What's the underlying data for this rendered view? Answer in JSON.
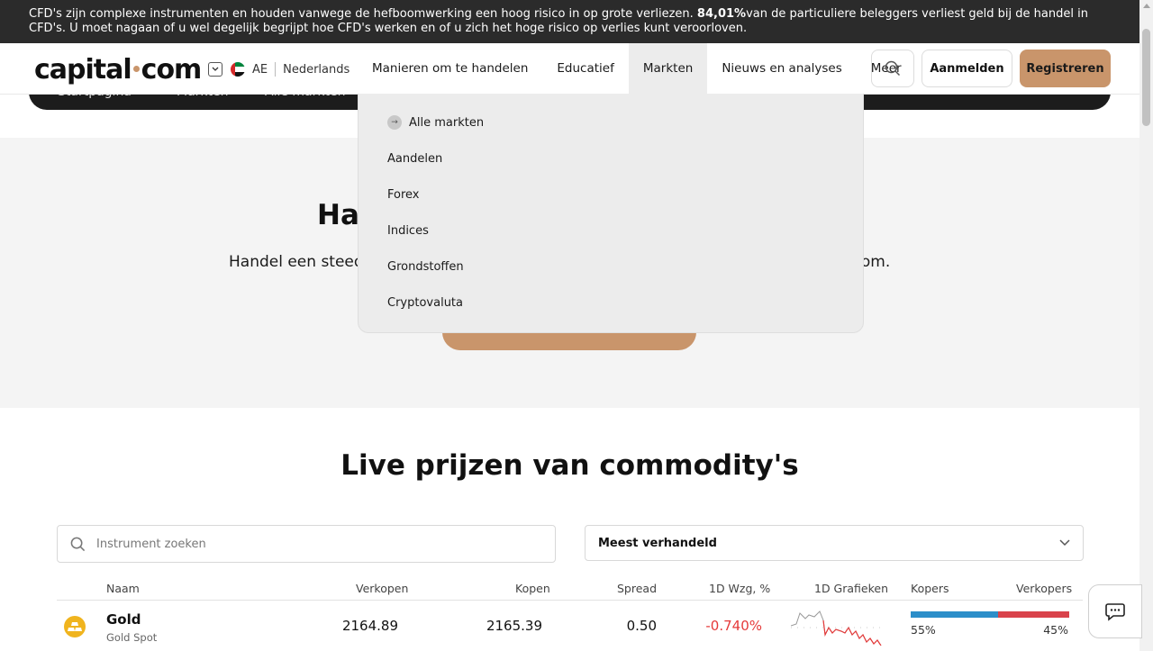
{
  "risk_warning": {
    "text_before": "CFD's zijn complexe instrumenten en houden vanwege de hefboomwerking een hoog risico in op grote verliezen. ",
    "percentage": "84,01%",
    "text_after": "van de particuliere beleggers verliest geld bij de handel in CFD's. U moet nagaan of u wel degelijk begrijpt hoe CFD's werken en of u zich het hoge risico op verlies kunt veroorloven."
  },
  "header": {
    "logo": {
      "part1": "capital",
      "part2": "com"
    },
    "region_code": "AE",
    "language": "Nederlands",
    "nav": [
      {
        "label": "Manieren om te handelen"
      },
      {
        "label": "Educatief"
      },
      {
        "label": "Markten"
      },
      {
        "label": "Nieuws en analyses"
      },
      {
        "label": "Meer"
      }
    ],
    "login_label": "Aanmelden",
    "register_label": "Registreren"
  },
  "breadcrumb": [
    "Startpagina",
    "Markten",
    "Alle markten"
  ],
  "hero": {
    "title_visible": "Han",
    "subtitle_left": "Handel een steed",
    "subtitle_right": "al.com."
  },
  "markets_dropdown": {
    "items": [
      {
        "label": "Alle markten"
      },
      {
        "label": "Aandelen"
      },
      {
        "label": "Forex"
      },
      {
        "label": "Indices"
      },
      {
        "label": "Grondstoffen"
      },
      {
        "label": "Cryptovaluta"
      }
    ]
  },
  "live_prices": {
    "title": "Live prijzen van commodity's",
    "search_placeholder": "Instrument zoeken",
    "sort_selected": "Meest verhandeld",
    "columns": {
      "name": "Naam",
      "sell": "Verkopen",
      "buy": "Kopen",
      "spread": "Spread",
      "change": "1D Wzg, %",
      "chart": "1D Grafieken",
      "buyers": "Kopers",
      "sellers": "Verkopers"
    },
    "rows": [
      {
        "name": "Gold",
        "subtitle": "Gold Spot",
        "sell": "2164.89",
        "buy": "2165.39",
        "spread": "0.50",
        "change": "-0.740%",
        "buyers_pct": "55%",
        "sellers_pct": "45%",
        "buyers_fraction": 0.55
      }
    ]
  },
  "colors": {
    "accent": "#c9956b",
    "banner_bg": "#2b2b2b",
    "negative": "#e53a3a",
    "buyers_bar": "#2c8ec9",
    "sellers_bar": "#d9434b"
  },
  "icons": {
    "search": "search-icon",
    "chevron": "chevron-down-icon",
    "chat": "chat-icon",
    "gold": "gold-bars-icon"
  }
}
